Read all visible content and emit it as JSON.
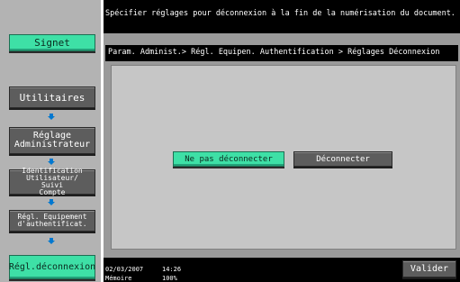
{
  "sidebar": {
    "signet_label": "Signet",
    "steps": [
      {
        "label": "Utilitaires"
      },
      {
        "label": "Réglage\nAdministrateur"
      },
      {
        "label": "Identification\nUtilisateur/\nSuivi\nCompte"
      },
      {
        "label": "Régl. Equipement\nd'authentificat."
      },
      {
        "label": "Régl.déconnexion"
      }
    ],
    "arrow_icon": "arrow-down-icon"
  },
  "header": {
    "message": "Spécifier réglages pour déconnexion à la fin de la numérisation du document."
  },
  "main": {
    "breadcrumb": "Param. Administ.> Régl. Equipen. Authentification > Réglages Déconnexion",
    "options": [
      {
        "label": "Ne pas déconnecter",
        "selected": true
      },
      {
        "label": "Déconnecter",
        "selected": false
      }
    ]
  },
  "status": {
    "date": "02/03/2007",
    "time": "14:26",
    "memory_label": "Mémoire",
    "memory_value": "100%"
  },
  "footer": {
    "validate_label": "Valider"
  },
  "colors": {
    "accent_green": "#3ee0a6",
    "panel_gray": "#9a9a9a",
    "bar_black": "#000000",
    "arrow_blue": "#0078d0"
  }
}
